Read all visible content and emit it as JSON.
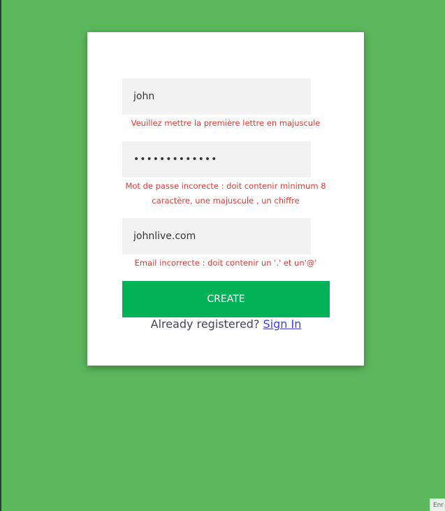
{
  "form": {
    "name_value": "john",
    "name_error": "Veuillez mettre la première lettre en majuscule",
    "password_value": "•••••••••••••",
    "password_error": "Mot de passe incorecte : doit contenir minimum 8 caractère, une majuscule , un chiffre",
    "email_value": "johnlive.com",
    "email_error": "Email incorrecte : doit contenir un '.' et un'@'",
    "create_label": "CREATE",
    "already_registered_text": "Already registered? ",
    "sign_in_link": "Sign In"
  },
  "corner_badge_text": "Enr",
  "colors": {
    "background": "#5cb85c",
    "card": "#ffffff",
    "field_bg": "#f2f2f2",
    "error": "#e53935",
    "button": "#00b157",
    "link": "#3f3fd8"
  }
}
